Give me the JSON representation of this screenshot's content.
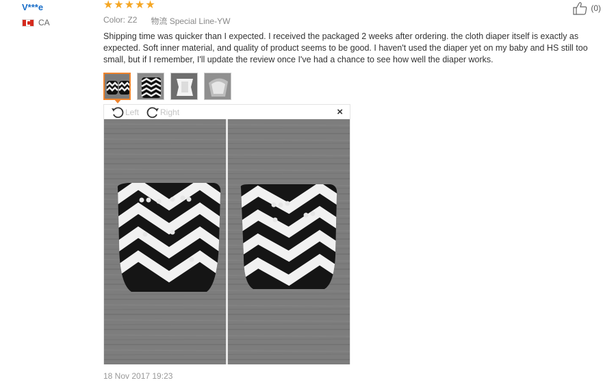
{
  "user": {
    "name": "V***e",
    "country_code": "CA"
  },
  "review": {
    "rating": 5,
    "color_label": "Color:",
    "color_value": "Z2",
    "shipping": "物流 Special Line-YW",
    "text": "Shipping time was quicker than I expected. I received the packaged 2 weeks after ordering. the cloth diaper itself is exactly as expected. Soft inner material, and quality of product seems to be good. I haven't used the diaper yet on my baby and HS still too small, but if I remember, I'll update the review once I've had a chance to see how well the diaper works.",
    "date": "18 Nov 2017 19:23"
  },
  "like": {
    "count": "(0)",
    "icon": "thumbs-up-icon"
  },
  "viewer": {
    "rotate_left_label": "Left",
    "rotate_right_label": "Right",
    "close_glyph": "×"
  },
  "thumbnails_count": 4,
  "colors": {
    "accent": "#f0842c",
    "star": "#f5a623",
    "username": "#1a6ec8"
  }
}
